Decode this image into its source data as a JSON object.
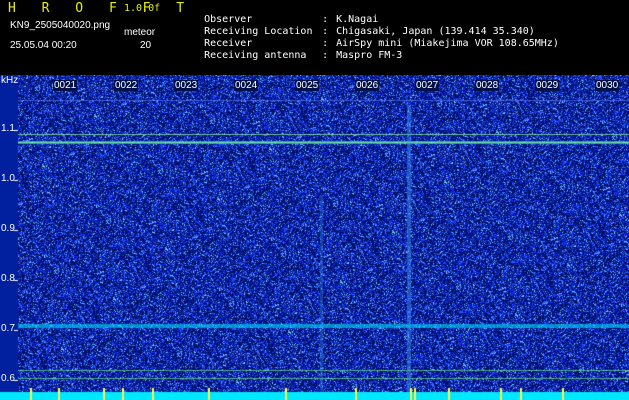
{
  "header": {
    "app_title": "H R O F F T",
    "version": "1.0.0f",
    "filename": "KN9_2505040020.png",
    "meteor_label": "meteor",
    "timestamp": "25.05.04 00:20",
    "meteor_count": "20"
  },
  "info": [
    {
      "label": "Observer",
      "sep": ":",
      "value": "K.Nagai"
    },
    {
      "label": "Receiving Location",
      "sep": ":",
      "value": "Chigasaki, Japan (139.414 35.340)"
    },
    {
      "label": "Receiver",
      "sep": ":",
      "value": "AirSpy mini (Miakejima VOR 108.65MHz)"
    },
    {
      "label": "Receiving antenna",
      "sep": ":",
      "value": "Maspro FM-3"
    }
  ],
  "spectrogram": {
    "axis_unit": "kHz",
    "y_ticks": [
      "1.1",
      "1.0",
      "0.9",
      "0.8",
      "0.7",
      "0.6"
    ],
    "x_ticks": [
      "0021",
      "0022",
      "0023",
      "0024",
      "0025",
      "0026",
      "0027",
      "0028",
      "0029",
      "0030"
    ],
    "colors": {
      "background": "#00106a",
      "noise": "#2040ff",
      "signal": "#00e0ff",
      "hot": "#ffff40",
      "bottom_band": "#00e8ff"
    }
  }
}
